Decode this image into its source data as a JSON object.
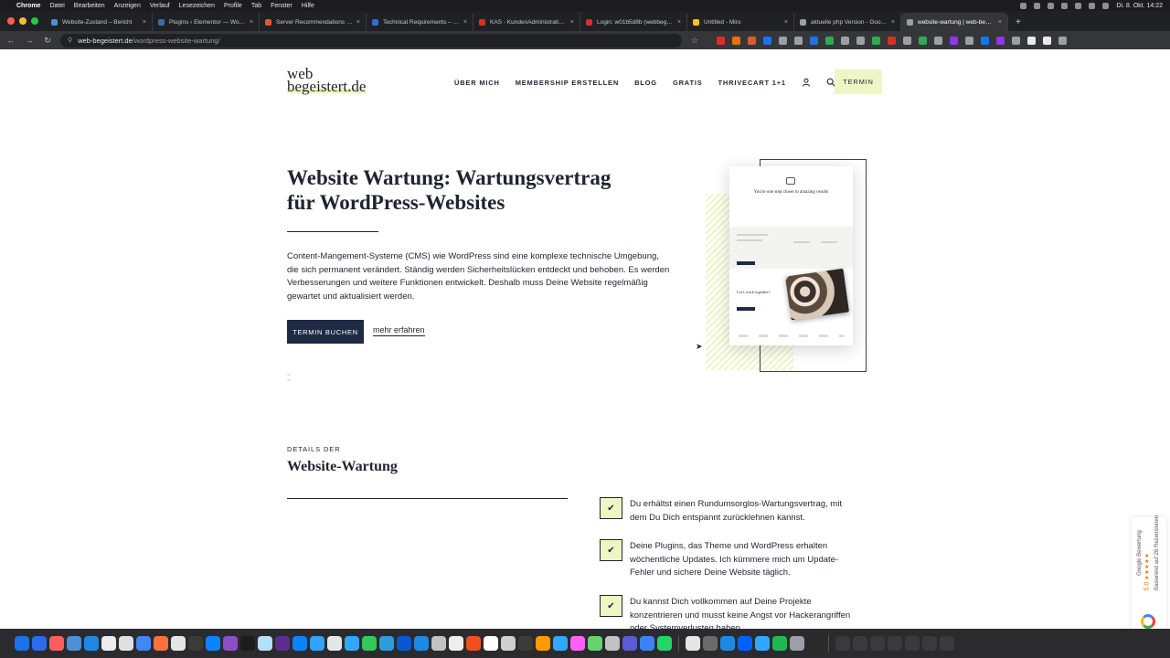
{
  "menubar": {
    "app_name": "Chrome",
    "items": [
      "Datei",
      "Bearbeiten",
      "Anzeigen",
      "Verlauf",
      "Lesezeichen",
      "Profile",
      "Tab",
      "Fenster",
      "Hilfe"
    ],
    "clock": "Di. 8. Okt. 14:22"
  },
  "tabs": [
    {
      "label": "Website-Zustand – Bericht",
      "color": "#4a90d9"
    },
    {
      "label": "Plugins ‹ Elementor — WordPress",
      "color": "#3b6ea5"
    },
    {
      "label": "Server Recommendations – Lea",
      "color": "#e05a2b"
    },
    {
      "label": "Technical Requirements – Lea",
      "color": "#2f6fdb"
    },
    {
      "label": "KAS - KundenAdministrationsSystem",
      "color": "#d93025"
    },
    {
      "label": "Login: w01b5d8b (webbegeistert)",
      "color": "#d93025"
    },
    {
      "label": "Untitled - Miro",
      "color": "#f5c518"
    },
    {
      "label": "aktuelle php Version - Google",
      "color": "#9aa0a6"
    },
    {
      "label": "website-wartung | web-begeistert",
      "color": "#9aa0a6"
    }
  ],
  "address_bar": {
    "host": "web-begeistert.de",
    "path": "/wordpress-website-wartung/"
  },
  "site": {
    "logo_line1": "web",
    "logo_line2": "begeistert.de",
    "nav": [
      "ÜBER MICH",
      "MEMBERSHIP ERSTELLEN",
      "BLOG",
      "GRATIS",
      "THRIVECART 1+1"
    ],
    "cta_nav": "TERMIN"
  },
  "hero": {
    "title_line1": "Website Wartung: Wartungsvertrag",
    "title_line2": "für WordPress-Websites",
    "text": "Content-Mangement-Systeme (CMS) wie WordPress sind eine komplexe technische Umgebung, die sich permanent verändert. Ständig werden Sicherheitslücken entdeckt und behoben. Es werden Verbesserungen und weitere Funktionen entwickelt. Deshalb muss Deine Website regelmäßig gewartet und aktualisiert werden.",
    "primary_button": "TERMIN BUCHEN",
    "secondary_link": "mehr erfahren"
  },
  "mockup": {
    "headline": "You're one step closer to amazing results",
    "subheadline": "Let's work together!"
  },
  "details": {
    "kicker": "DETAILS DER",
    "title": "Website-Wartung",
    "features": [
      "Du erhältst einen Rundumsorglos-Wartungsvertrag, mit dem Du Dich entspannt zurücklehnen kannst.",
      "Deine Plugins, das Theme und WordPress erhalten wöchentliche Updates. Ich kümmere mich um Update-Fehler und sichere Deine Website täglich.",
      "Du kannst Dich vollkommen auf Deine Projekte konzentrieren und musst keine Angst vor Hackerangriffen oder Systemverlusten haben."
    ]
  },
  "google_badge": {
    "label": "Google Bewertung",
    "score": "5.0",
    "reviews": "Basierend auf 26 Rezensionen"
  },
  "colors": {
    "accent_lime": "#eef6c4",
    "navy": "#1f2a44"
  }
}
